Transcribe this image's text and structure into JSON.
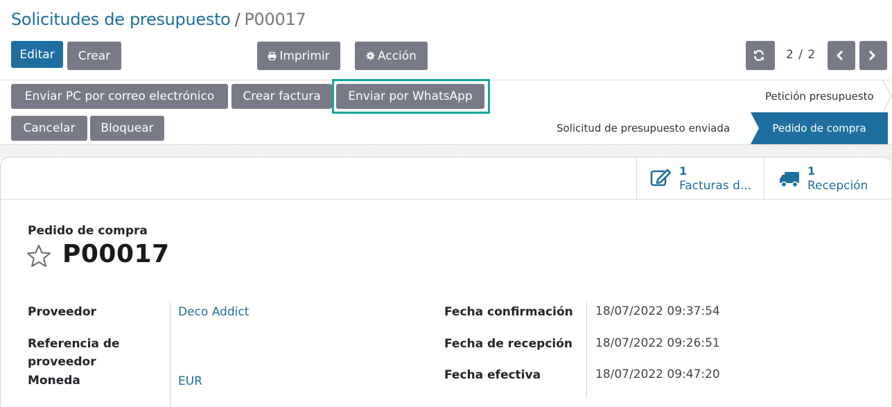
{
  "breadcrumb": {
    "parent": "Solicitudes de presupuesto",
    "separator": "/",
    "current": "P00017"
  },
  "toolbar": {
    "edit_label": "Editar",
    "create_label": "Crear",
    "print_label": "Imprimir",
    "action_label": "Acción"
  },
  "pager": {
    "text": "2 / 2"
  },
  "status_buttons": {
    "send_email_label": "Enviar PC por correo electrónico",
    "create_invoice_label": "Crear factura",
    "send_whatsapp_label": "Enviar por WhatsApp",
    "cancel_label": "Cancelar",
    "lock_label": "Bloquear"
  },
  "statusbar": {
    "states": [
      "Petición presupuesto",
      "Solicitud de presupuesto enviada",
      "Pedido de compra"
    ],
    "active": "Pedido de compra"
  },
  "smart_buttons": [
    {
      "icon": "pencil-square-icon",
      "count": "1",
      "label": "Facturas d..."
    },
    {
      "icon": "truck-icon",
      "count": "1",
      "label": "Recepción"
    }
  ],
  "form": {
    "type_label": "Pedido de compra",
    "reference": "P00017",
    "left_fields": [
      {
        "label": "Proveedor",
        "value": "Deco Addict"
      },
      {
        "label": "Referencia de proveedor",
        "value": ""
      },
      {
        "label": "Moneda",
        "value": "EUR"
      }
    ],
    "right_fields": [
      {
        "label": "Fecha confirmación",
        "value": "18/07/2022 09:37:54"
      },
      {
        "label": "Fecha de recepción",
        "value": "18/07/2022 09:26:51"
      },
      {
        "label": "Fecha efectiva",
        "value": "18/07/2022 09:47:20"
      }
    ]
  },
  "colors": {
    "primary": "#1e6f9f",
    "secondary": "#787a88",
    "highlight": "#13a59a",
    "link": "#1f6f9e"
  }
}
